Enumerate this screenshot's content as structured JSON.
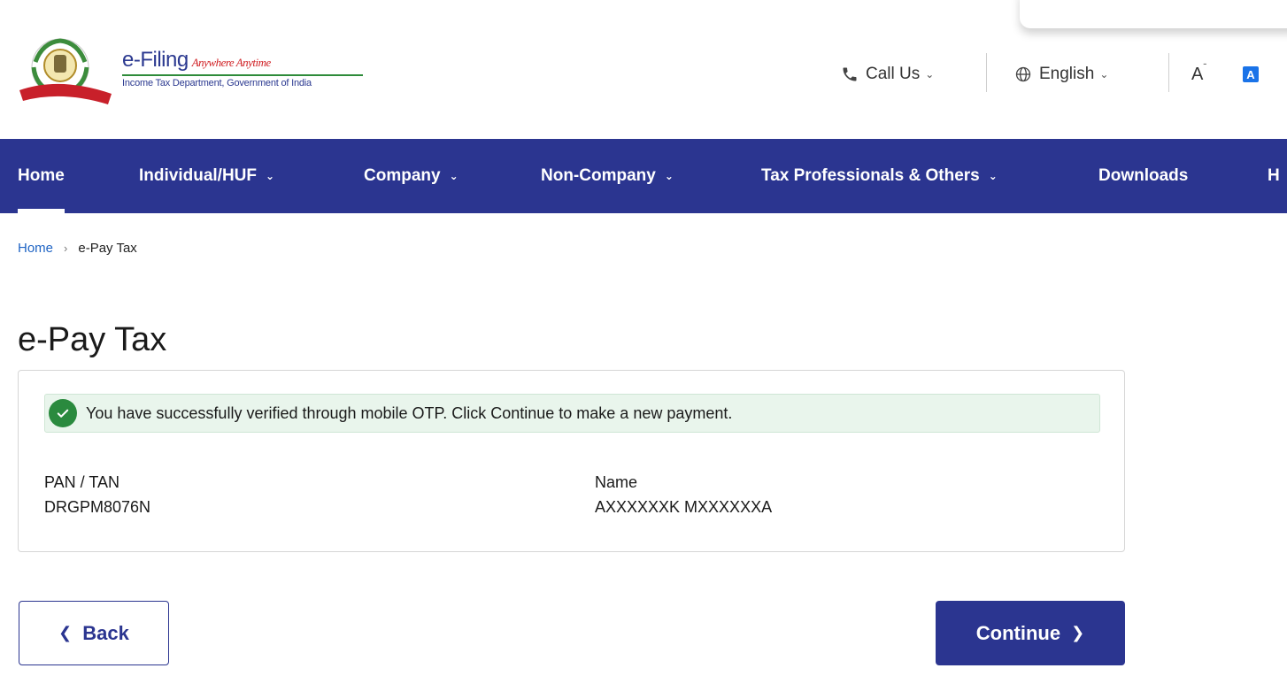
{
  "header": {
    "brand_title": "e-Filing",
    "brand_tagline": "Anywhere Anytime",
    "brand_subtitle": "Income Tax Department, Government of India",
    "call_us": "Call Us",
    "language": "English",
    "font_size_label": "A",
    "contrast_label": "A"
  },
  "nav": {
    "items": [
      {
        "label": "Home",
        "active": true
      },
      {
        "label": "Individual/HUF",
        "has_dropdown": true
      },
      {
        "label": "Company",
        "has_dropdown": true
      },
      {
        "label": "Non-Company",
        "has_dropdown": true
      },
      {
        "label": "Tax Professionals & Others",
        "has_dropdown": true
      },
      {
        "label": "Downloads"
      },
      {
        "label": "H"
      }
    ]
  },
  "breadcrumb": {
    "home": "Home",
    "current": "e-Pay Tax"
  },
  "page": {
    "title": "e-Pay Tax"
  },
  "card": {
    "alert_message": "You have successfully verified through mobile OTP. Click Continue to make a new payment.",
    "pan_label": "PAN / TAN",
    "pan_value": "DRGPM8076N",
    "name_label": "Name",
    "name_value": "AXXXXXXK MXXXXXXA"
  },
  "buttons": {
    "back": "Back",
    "continue": "Continue"
  },
  "colors": {
    "primary": "#2b3590",
    "success": "#2a8a3e",
    "alert_bg": "#e9f5ec",
    "link": "#1f64c4"
  }
}
